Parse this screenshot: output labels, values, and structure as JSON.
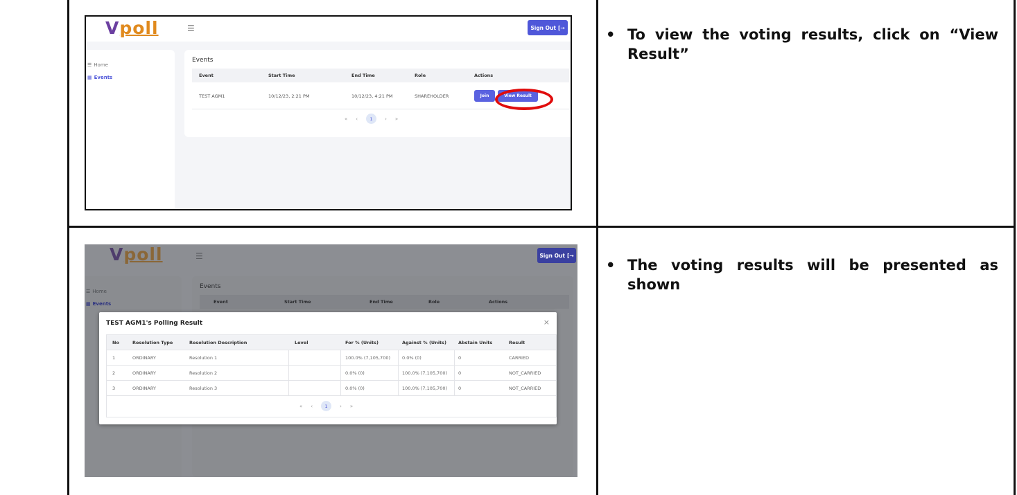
{
  "app": {
    "logo_v": "V",
    "logo_rest": "poll",
    "menu_icon": "☰",
    "signout_label": "Sign Out",
    "signout_icon": "[→"
  },
  "sidebar": {
    "home_label": "Home",
    "events_label": "Events"
  },
  "events": {
    "title": "Events",
    "columns": [
      "Event",
      "Start Time",
      "End Time",
      "Role",
      "Actions"
    ],
    "row": {
      "event": "TEST AGM1",
      "start": "10/12/23, 2:21 PM",
      "end": "10/12/23, 4:21 PM",
      "role": "SHAREHOLDER"
    },
    "join_label": "Join",
    "view_result_label": "View Result",
    "pager": {
      "first": "«",
      "prev": "‹",
      "page": "1",
      "next": "›",
      "last": "»"
    }
  },
  "modal": {
    "title": "TEST AGM1's Polling Result",
    "close": "×",
    "columns": [
      "No",
      "Resolution Type",
      "Resolution Description",
      "Level",
      "For % (Units)",
      "Against % (Units)",
      "Abstain Units",
      "Result"
    ],
    "rows": [
      [
        "1",
        "ORDINARY",
        "Resolution 1",
        "",
        "100.0% (7,105,700)",
        "0.0% (0)",
        "0",
        "CARRIED"
      ],
      [
        "2",
        "ORDINARY",
        "Resolution 2",
        "",
        "0.0% (0)",
        "100.0% (7,105,700)",
        "0",
        "NOT_CARRIED"
      ],
      [
        "3",
        "ORDINARY",
        "Resolution 3",
        "",
        "0.0% (0)",
        "100.0% (7,105,700)",
        "0",
        "NOT_CARRIED"
      ]
    ],
    "pager": {
      "first": "«",
      "prev": "‹",
      "page": "1",
      "next": "›",
      "last": "»"
    }
  },
  "instructions": [
    {
      "bullet": "•",
      "text": "To view the voting results, click on “View Result”"
    },
    {
      "bullet": "•",
      "text": "The voting results will be presented as shown"
    }
  ]
}
